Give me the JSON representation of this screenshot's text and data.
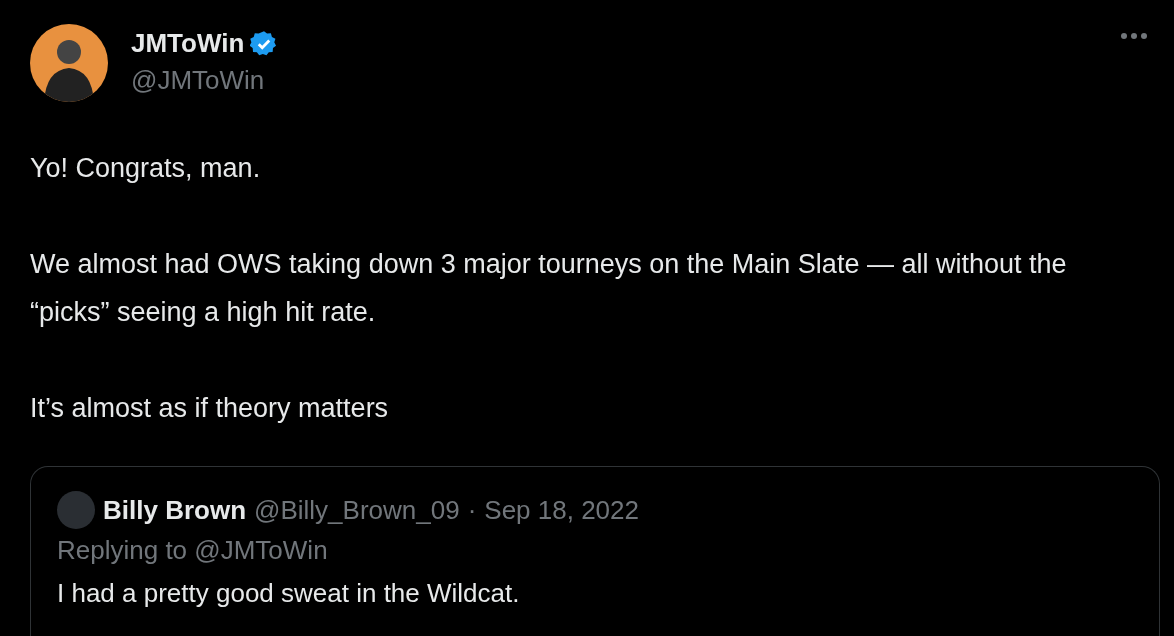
{
  "tweet": {
    "author": {
      "name": "JMToWin",
      "verified": true,
      "handle": "@JMToWin"
    },
    "paragraphs": [
      "Yo! Congrats, man.",
      "We almost had OWS taking down 3 major tourneys on the Main Slate — all without the “picks” seeing a high hit rate.",
      "It’s almost as if theory matters"
    ],
    "quoted": {
      "name": "Billy Brown",
      "handle": "@Billy_Brown_09",
      "separator": "·",
      "date": "Sep 18, 2022",
      "replying_label": "Replying to",
      "replying_to": "@JMToWin",
      "text": "I had a pretty good sweat in the Wildcat."
    }
  }
}
